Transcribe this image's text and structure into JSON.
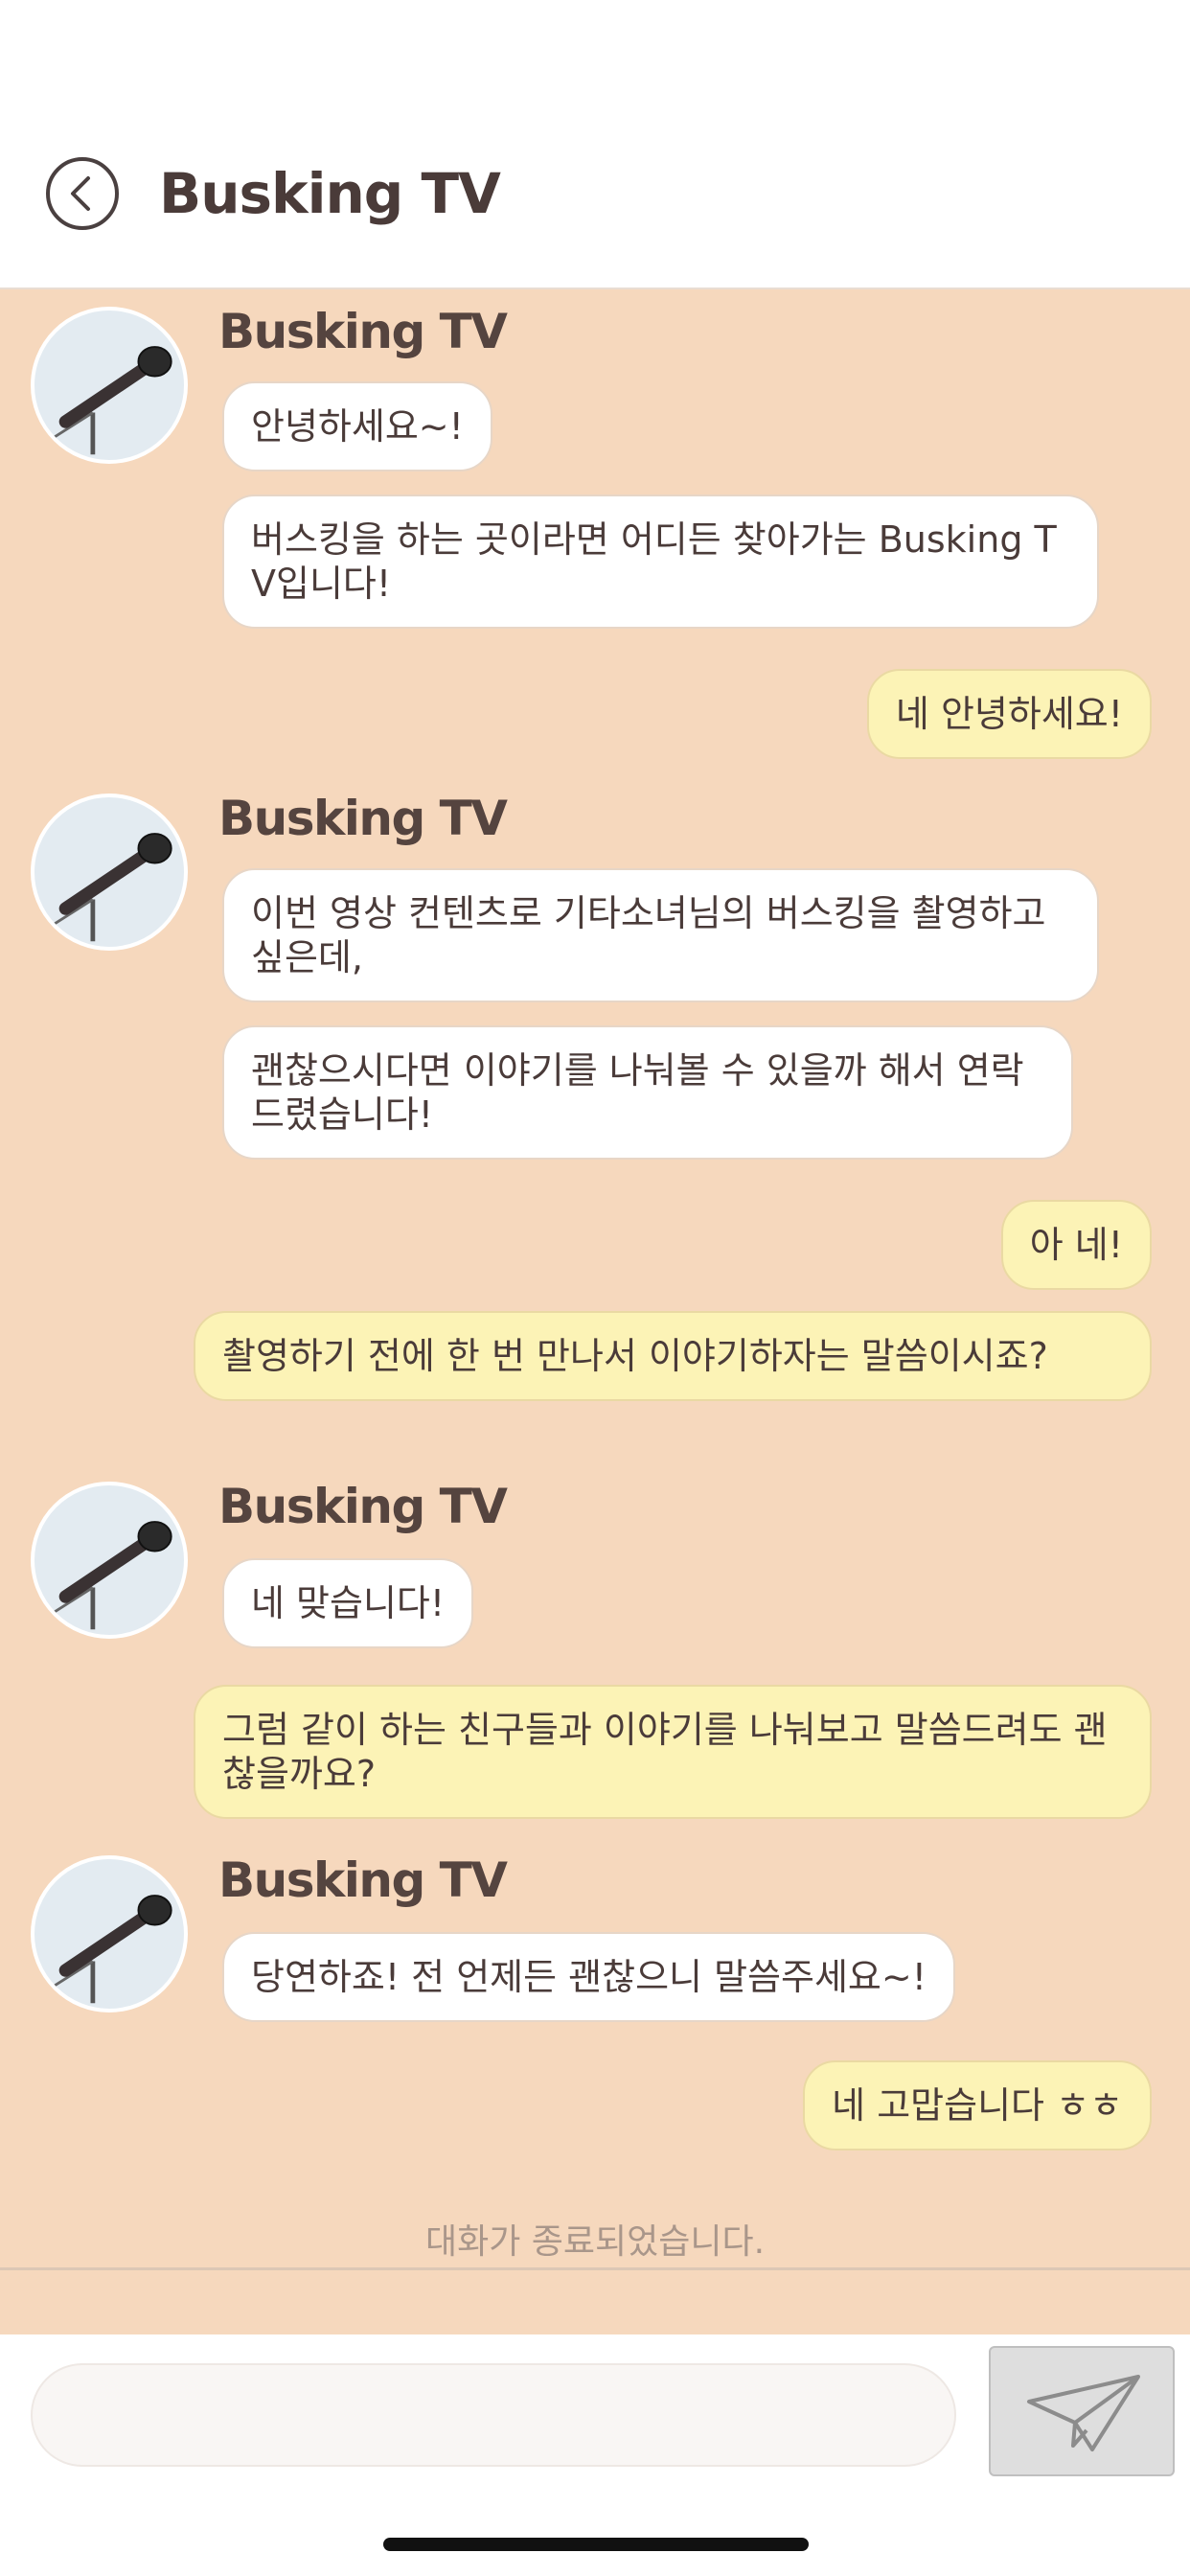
{
  "header": {
    "title": "Busking TV",
    "back_icon": "chevron-left-circle-icon"
  },
  "chat": {
    "background": "#f6d8bd",
    "avatar_icon": "microphone-icon",
    "groups": [
      {
        "sender": "Busking TV",
        "messages": [
          "안녕하세요~!",
          "버스킹을 하는 곳이라면 어디든 찾아가는 Busking TV입니다!"
        ]
      },
      {
        "sender": "Busking TV",
        "messages": [
          "이번 영상 컨텐츠로 기타소녀님의 버스킹을 촬영하고 싶은데,",
          "괜찮으시다면 이야기를 나눠볼 수 있을까 해서 연락드렸습니다!"
        ]
      },
      {
        "sender": "Busking TV",
        "messages": [
          "네 맞습니다!"
        ]
      },
      {
        "sender": "Busking TV",
        "messages": [
          "당연하죠! 전 언제든 괜찮으니 말씀주세요~!"
        ]
      }
    ],
    "replies": [
      "네 안녕하세요!",
      "아 네!",
      "촬영하기 전에 한 번 만나서 이야기하자는 말씀이시죠?",
      "그럼 같이 하는 친구들과 이야기를 나눠보고 말씀드려도 괜찮을까요?",
      "네 고맙습니다 ㅎㅎ"
    ],
    "end_notice": "대화가 종료되었습니다."
  },
  "input": {
    "value": "",
    "placeholder": "",
    "send_icon": "paper-plane-icon"
  },
  "colors": {
    "incoming_bubble": "#ffffff",
    "outgoing_bubble": "#fcf3b6",
    "text": "#4a3b39"
  }
}
